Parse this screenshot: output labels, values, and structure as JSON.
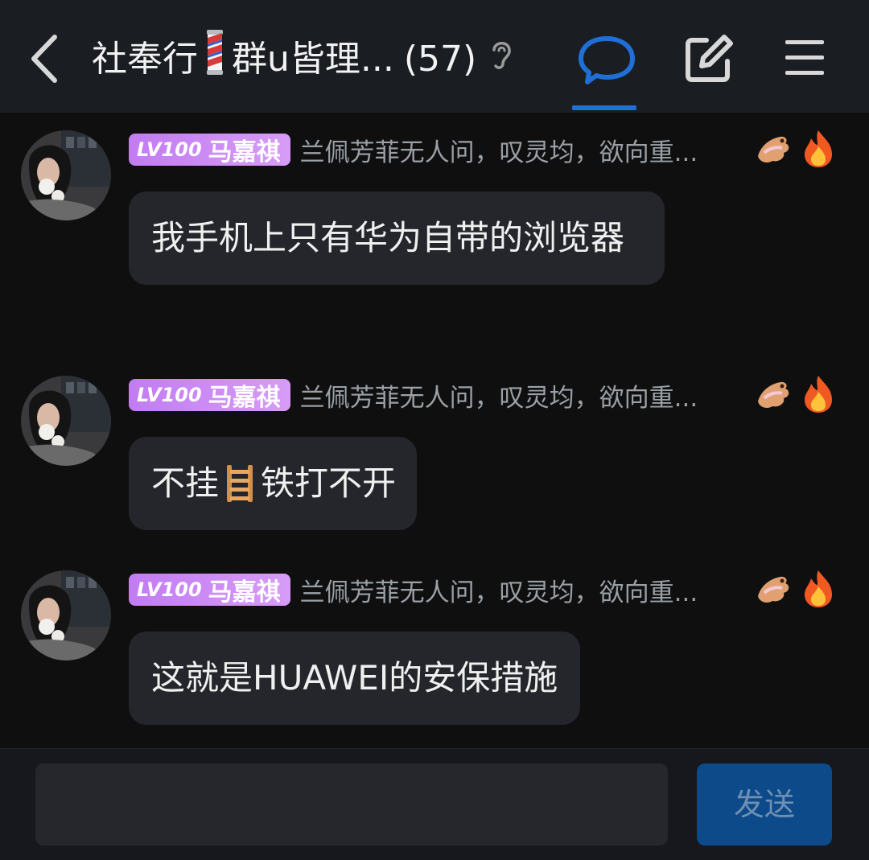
{
  "header": {
    "title_prefix": "社奉行",
    "title_suffix": "群u皆理...",
    "member_count": "(57)"
  },
  "messages": [
    {
      "badge_level": "LV100",
      "badge_name": "马嘉祺",
      "signature": "兰佩芳菲无人问，叹灵均，欲向重...",
      "text": "我手机上只有华为自带的浏览器"
    },
    {
      "badge_level": "LV100",
      "badge_name": "马嘉祺",
      "signature": "兰佩芳菲无人问，叹灵均，欲向重...",
      "text_before": "不挂",
      "text_after": "铁打不开"
    },
    {
      "badge_level": "LV100",
      "badge_name": "马嘉祺",
      "signature": "兰佩芳菲无人问，叹灵均，欲向重...",
      "text": "这就是HUAWEI的安保措施"
    }
  ],
  "composer": {
    "placeholder": "",
    "send_label": "发送"
  },
  "icons": {
    "back": "chevron-left-icon",
    "chat": "chat-bubble-icon",
    "edit": "edit-icon",
    "menu": "menu-icon",
    "ear": "ear-icon",
    "barber_pole": "barber-pole-emoji",
    "ladder": "ladder-emoji",
    "dragon": "dragon-icon",
    "fire": "fire-icon"
  },
  "colors": {
    "accent": "#1f6fd6",
    "badge": "#c27cf2",
    "bubble": "#24262b"
  }
}
